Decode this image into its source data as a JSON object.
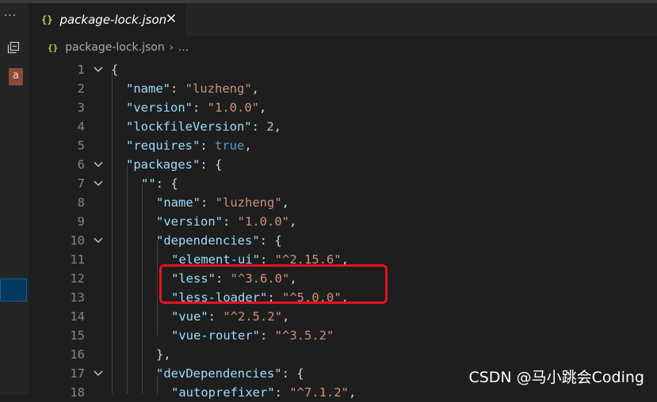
{
  "tab": {
    "title": "package-lock.json",
    "icon": "json-braces-icon"
  },
  "breadcrumb": {
    "file": "package-lock.json",
    "more": "..."
  },
  "sidebar": {
    "more_label": "···",
    "badge_label": "a"
  },
  "editor": {
    "lines": [
      {
        "n": "1",
        "fold": true
      },
      {
        "n": "2",
        "fold": false
      },
      {
        "n": "3",
        "fold": false
      },
      {
        "n": "4",
        "fold": false
      },
      {
        "n": "5",
        "fold": false
      },
      {
        "n": "6",
        "fold": true
      },
      {
        "n": "7",
        "fold": true
      },
      {
        "n": "8",
        "fold": false
      },
      {
        "n": "9",
        "fold": false
      },
      {
        "n": "10",
        "fold": true
      },
      {
        "n": "11",
        "fold": false
      },
      {
        "n": "12",
        "fold": false
      },
      {
        "n": "13",
        "fold": false
      },
      {
        "n": "14",
        "fold": false
      },
      {
        "n": "15",
        "fold": false
      },
      {
        "n": "16",
        "fold": false
      },
      {
        "n": "17",
        "fold": true
      },
      {
        "n": "18",
        "fold": false
      }
    ],
    "code": {
      "l1_open": "{",
      "name_key": "\"name\"",
      "name_val": "\"luzheng\"",
      "version_key": "\"version\"",
      "version_val": "\"1.0.0\"",
      "lockfile_key": "\"lockfileVersion\"",
      "lockfile_val": "2",
      "requires_key": "\"requires\"",
      "requires_val": "true",
      "packages_key": "\"packages\"",
      "empty_key": "\"\"",
      "pkg_name_key": "\"name\"",
      "pkg_name_val": "\"luzheng\"",
      "pkg_version_key": "\"version\"",
      "pkg_version_val": "\"1.0.0\"",
      "deps_key": "\"dependencies\"",
      "elementui_key": "\"element-ui\"",
      "elementui_val": "\"^2.15.6\"",
      "less_key": "\"less\"",
      "less_val": "\"^3.6.0\"",
      "lessloader_key": "\"less-loader\"",
      "lessloader_val": "\"^5.0.0\"",
      "vue_key": "\"vue\"",
      "vue_val": "\"^2.5.2\"",
      "vuerouter_key": "\"vue-router\"",
      "vuerouter_val": "\"^3.5.2\"",
      "close16": "},",
      "devdeps_key": "\"devDependencies\"",
      "autoprefixer_key": "\"autoprefixer\"",
      "autoprefixer_val": "\"^7.1.2\""
    }
  },
  "watermark": "CSDN @马小跳会Coding",
  "colors": {
    "key": "#9cdcfe",
    "string": "#ce9178",
    "number": "#b5cea8",
    "boolean": "#569cd6",
    "highlight_box": "#e81123"
  }
}
